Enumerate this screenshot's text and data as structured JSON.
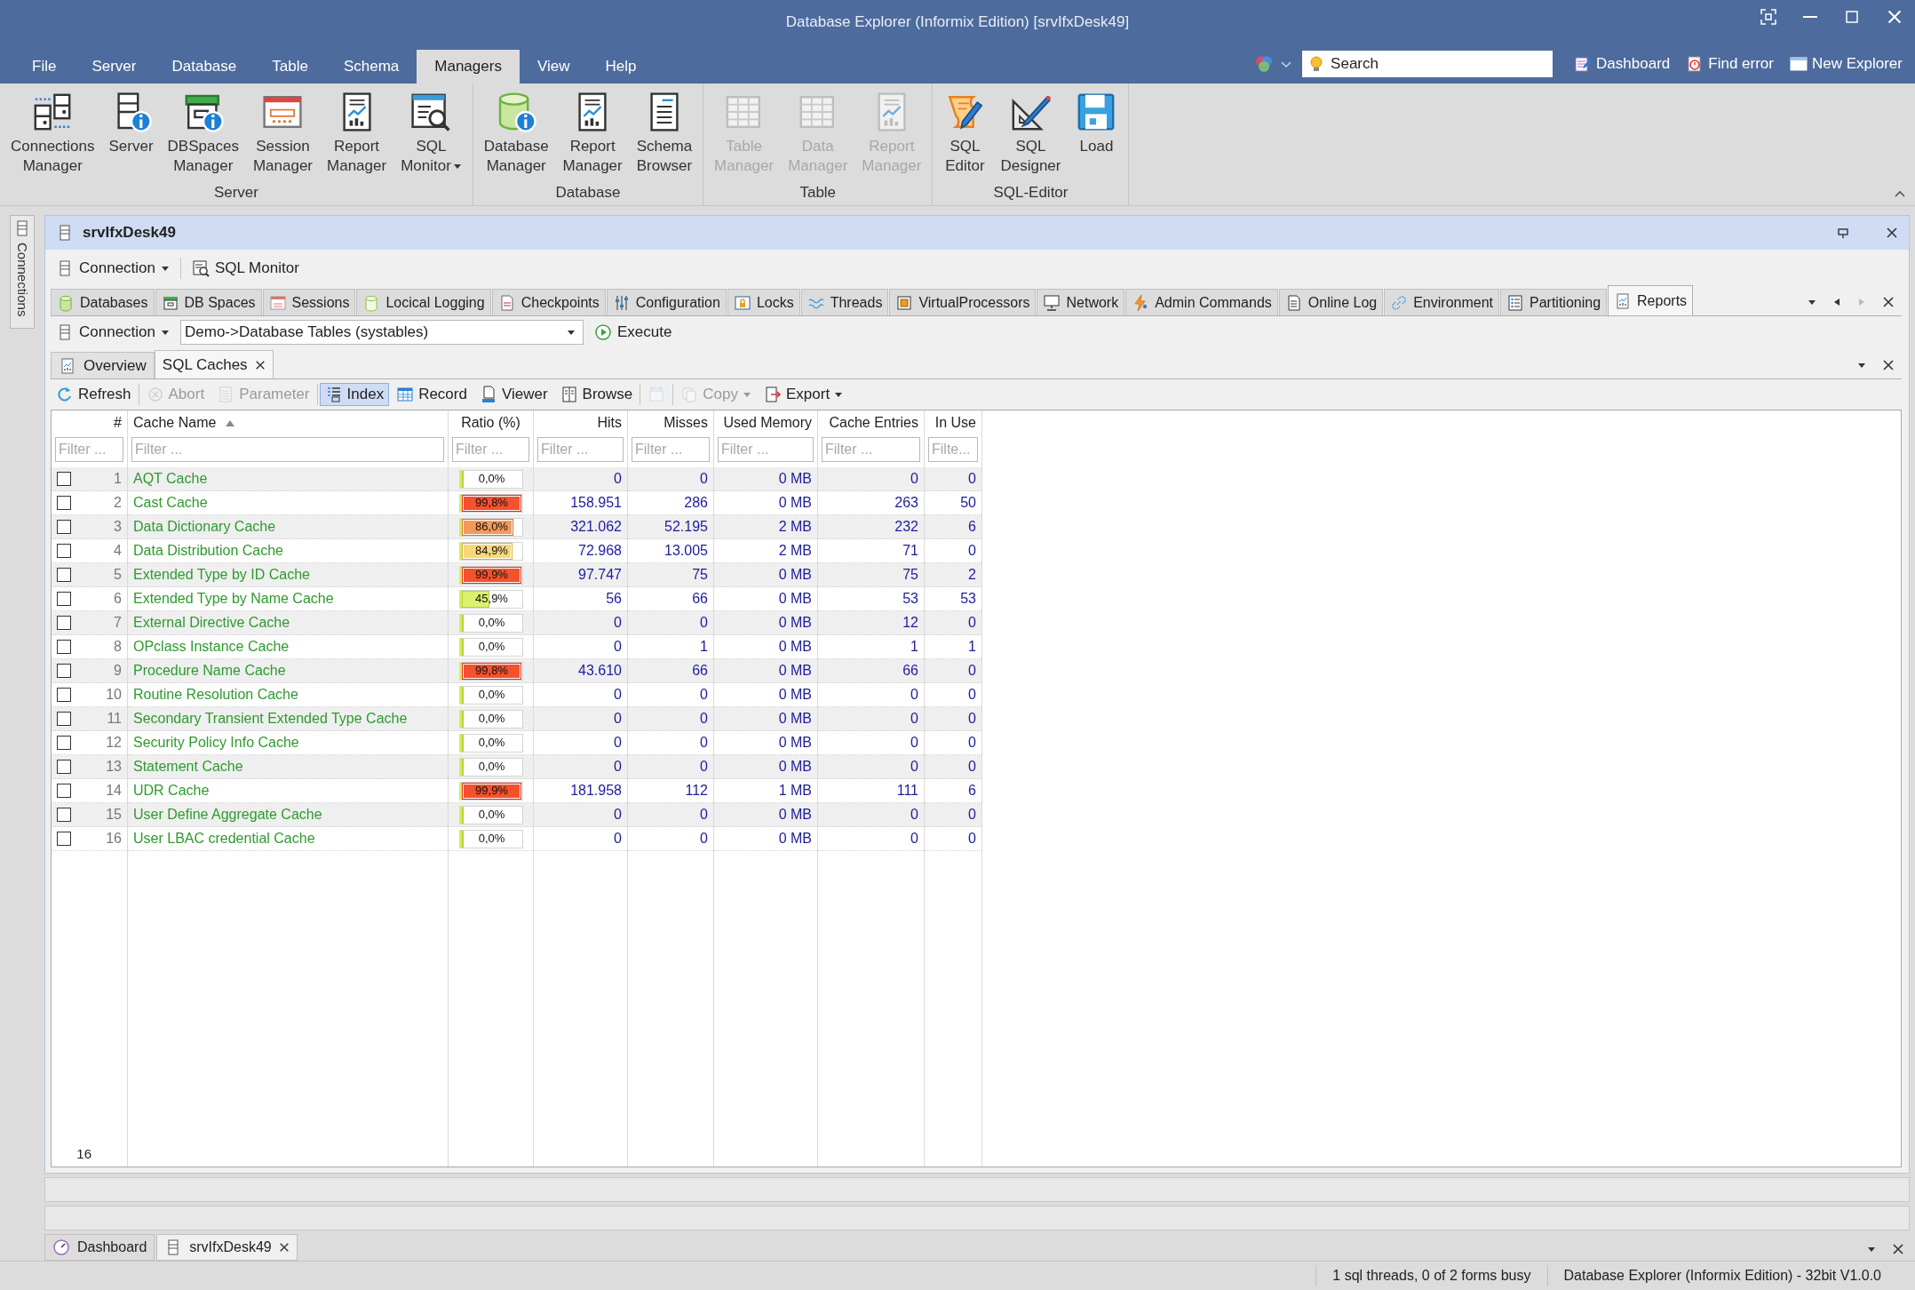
{
  "window": {
    "title": "Database Explorer (Informix Edition) [srvIfxDesk49]"
  },
  "menu": [
    {
      "label": "File",
      "selected": false
    },
    {
      "label": "Server",
      "selected": false
    },
    {
      "label": "Database",
      "selected": false
    },
    {
      "label": "Table",
      "selected": false
    },
    {
      "label": "Schema",
      "selected": false
    },
    {
      "label": "Managers",
      "selected": true
    },
    {
      "label": "View",
      "selected": false
    },
    {
      "label": "Help",
      "selected": false
    }
  ],
  "search": {
    "placeholder": "Search"
  },
  "quick_links": [
    "Dashboard",
    "Find error",
    "New Explorer"
  ],
  "ribbon": [
    {
      "label": "Server",
      "buttons": [
        {
          "lines": [
            "Connections",
            "Manager"
          ],
          "disabled": false,
          "dropdown": false
        },
        {
          "lines": [
            "Server"
          ],
          "disabled": false,
          "dropdown": false
        },
        {
          "lines": [
            "DBSpaces",
            "Manager"
          ],
          "disabled": false,
          "dropdown": false
        },
        {
          "lines": [
            "Session",
            "Manager"
          ],
          "disabled": false,
          "dropdown": false
        },
        {
          "lines": [
            "Report",
            "Manager"
          ],
          "disabled": false,
          "dropdown": false
        },
        {
          "lines": [
            "SQL",
            "Monitor"
          ],
          "disabled": false,
          "dropdown": true
        }
      ]
    },
    {
      "label": "Database",
      "buttons": [
        {
          "lines": [
            "Database",
            "Manager"
          ],
          "disabled": false,
          "dropdown": false
        },
        {
          "lines": [
            "Report",
            "Manager"
          ],
          "disabled": false,
          "dropdown": false
        },
        {
          "lines": [
            "Schema",
            "Browser"
          ],
          "disabled": false,
          "dropdown": false
        }
      ]
    },
    {
      "label": "Table",
      "buttons": [
        {
          "lines": [
            "Table",
            "Manager"
          ],
          "disabled": true,
          "dropdown": false
        },
        {
          "lines": [
            "Data",
            "Manager"
          ],
          "disabled": true,
          "dropdown": false
        },
        {
          "lines": [
            "Report",
            "Manager"
          ],
          "disabled": true,
          "dropdown": false
        }
      ]
    },
    {
      "label": "SQL-Editor",
      "buttons": [
        {
          "lines": [
            "SQL",
            "Editor"
          ],
          "disabled": false,
          "dropdown": false
        },
        {
          "lines": [
            "SQL",
            "Designer"
          ],
          "disabled": false,
          "dropdown": false
        },
        {
          "lines": [
            "Load"
          ],
          "disabled": false,
          "dropdown": false
        }
      ]
    }
  ],
  "side_panel": {
    "label": "Connections"
  },
  "document": {
    "title": "srvIfxDesk49",
    "toolbar": [
      {
        "label": "Connection",
        "dropdown": true
      },
      {
        "label": "SQL Monitor",
        "dropdown": false
      }
    ],
    "tabs": [
      {
        "label": "Databases",
        "selected": false
      },
      {
        "label": "DB Spaces",
        "selected": false
      },
      {
        "label": "Sessions",
        "selected": false
      },
      {
        "label": "Locical Logging",
        "selected": false
      },
      {
        "label": "Checkpoints",
        "selected": false
      },
      {
        "label": "Configuration",
        "selected": false
      },
      {
        "label": "Locks",
        "selected": false
      },
      {
        "label": "Threads",
        "selected": false
      },
      {
        "label": "VirtualProcessors",
        "selected": false
      },
      {
        "label": "Network",
        "selected": false
      },
      {
        "label": "Admin Commands",
        "selected": false
      },
      {
        "label": "Online Log",
        "selected": false
      },
      {
        "label": "Environment",
        "selected": false
      },
      {
        "label": "Partitioning",
        "selected": false
      },
      {
        "label": "Reports",
        "selected": true
      }
    ],
    "query": {
      "connection": "Connection",
      "source": "Demo->Database Tables (systables)",
      "run": "Execute"
    },
    "report_tabs": [
      {
        "label": "Overview",
        "selected": false,
        "closable": false
      },
      {
        "label": "SQL Caches",
        "selected": true,
        "closable": true
      }
    ],
    "actions": [
      {
        "label": "Refresh",
        "disabled": false,
        "on": false,
        "dropdown": false
      },
      {
        "label": "Abort",
        "disabled": true,
        "on": false,
        "dropdown": false
      },
      {
        "label": "Parameter",
        "disabled": true,
        "on": false,
        "dropdown": false
      },
      {
        "label": "Index",
        "disabled": false,
        "on": true,
        "dropdown": false
      },
      {
        "label": "Record",
        "disabled": false,
        "on": false,
        "dropdown": false
      },
      {
        "label": "Viewer",
        "disabled": false,
        "on": false,
        "dropdown": false
      },
      {
        "label": "Browse",
        "disabled": false,
        "on": false,
        "dropdown": false
      },
      {
        "disabled": true,
        "on": false,
        "dropdown": false
      },
      {
        "label": "Copy",
        "disabled": true,
        "on": false,
        "dropdown": true
      },
      {
        "label": "Export",
        "disabled": false,
        "on": false,
        "dropdown": true
      }
    ],
    "table": {
      "columns": [
        {
          "label": "#",
          "sorted": false,
          "filter_placeholder": "Filter ..."
        },
        {
          "label": "Cache Name",
          "sorted": true,
          "filter_placeholder": "Filter ..."
        },
        {
          "label": "Ratio (%)",
          "sorted": false,
          "filter_placeholder": "Filter ..."
        },
        {
          "label": "Hits",
          "sorted": false,
          "filter_placeholder": "Filter ..."
        },
        {
          "label": "Misses",
          "sorted": false,
          "filter_placeholder": "Filter ..."
        },
        {
          "label": "Used Memory",
          "sorted": false,
          "filter_placeholder": "Filter ..."
        },
        {
          "label": "Cache Entries",
          "sorted": false,
          "filter_placeholder": "Filter ..."
        },
        {
          "label": "In Use",
          "sorted": false,
          "filter_placeholder": "Filte..."
        }
      ],
      "rows": [
        {
          "checked": false,
          "number": "1",
          "name": "AQT Cache",
          "level": 0,
          "ratio": "0,0%",
          "hits": "0",
          "misses": "0",
          "used_memory": "0 MB",
          "cache_entries": "0",
          "in_use": "0"
        },
        {
          "checked": false,
          "number": "2",
          "name": "Cast Cache",
          "level": 0.998,
          "ratio": "99,8%",
          "hits": "158.951",
          "misses": "286",
          "used_memory": "0 MB",
          "cache_entries": "263",
          "in_use": "50"
        },
        {
          "checked": false,
          "number": "3",
          "name": "Data Dictionary Cache",
          "level": 0.86,
          "ratio": "86,0%",
          "hits": "321.062",
          "misses": "52.195",
          "used_memory": "2 MB",
          "cache_entries": "232",
          "in_use": "6"
        },
        {
          "checked": false,
          "number": "4",
          "name": "Data Distribution Cache",
          "level": 0.849,
          "ratio": "84,9%",
          "hits": "72.968",
          "misses": "13.005",
          "used_memory": "2 MB",
          "cache_entries": "71",
          "in_use": "0"
        },
        {
          "checked": false,
          "number": "5",
          "name": "Extended Type by ID Cache",
          "level": 0.999,
          "ratio": "99,9%",
          "hits": "97.747",
          "misses": "75",
          "used_memory": "0 MB",
          "cache_entries": "75",
          "in_use": "2"
        },
        {
          "checked": false,
          "number": "6",
          "name": "Extended Type by Name Cache",
          "level": 0.459,
          "ratio": "45,9%",
          "hits": "56",
          "misses": "66",
          "used_memory": "0 MB",
          "cache_entries": "53",
          "in_use": "53"
        },
        {
          "checked": false,
          "number": "7",
          "name": "External Directive Cache",
          "level": 0,
          "ratio": "0,0%",
          "hits": "0",
          "misses": "0",
          "used_memory": "0 MB",
          "cache_entries": "12",
          "in_use": "0"
        },
        {
          "checked": false,
          "number": "8",
          "name": "OPclass Instance Cache",
          "level": 0,
          "ratio": "0,0%",
          "hits": "0",
          "misses": "1",
          "used_memory": "0 MB",
          "cache_entries": "1",
          "in_use": "1"
        },
        {
          "checked": false,
          "number": "9",
          "name": "Procedure Name Cache",
          "level": 0.998,
          "ratio": "99,8%",
          "hits": "43.610",
          "misses": "66",
          "used_memory": "0 MB",
          "cache_entries": "66",
          "in_use": "0"
        },
        {
          "checked": false,
          "number": "10",
          "name": "Routine Resolution Cache",
          "level": 0,
          "ratio": "0,0%",
          "hits": "0",
          "misses": "0",
          "used_memory": "0 MB",
          "cache_entries": "0",
          "in_use": "0"
        },
        {
          "checked": false,
          "number": "11",
          "name": "Secondary Transient Extended Type Cache",
          "level": 0,
          "ratio": "0,0%",
          "hits": "0",
          "misses": "0",
          "used_memory": "0 MB",
          "cache_entries": "0",
          "in_use": "0"
        },
        {
          "checked": false,
          "number": "12",
          "name": "Security Policy Info Cache",
          "level": 0,
          "ratio": "0,0%",
          "hits": "0",
          "misses": "0",
          "used_memory": "0 MB",
          "cache_entries": "0",
          "in_use": "0"
        },
        {
          "checked": false,
          "number": "13",
          "name": "Statement Cache",
          "level": 0,
          "ratio": "0,0%",
          "hits": "0",
          "misses": "0",
          "used_memory": "0 MB",
          "cache_entries": "0",
          "in_use": "0"
        },
        {
          "checked": false,
          "number": "14",
          "name": "UDR Cache",
          "level": 0.999,
          "ratio": "99,9%",
          "hits": "181.958",
          "misses": "112",
          "used_memory": "1 MB",
          "cache_entries": "111",
          "in_use": "6"
        },
        {
          "checked": false,
          "number": "15",
          "name": "User Define Aggregate Cache",
          "level": 0,
          "ratio": "0,0%",
          "hits": "0",
          "misses": "0",
          "used_memory": "0 MB",
          "cache_entries": "0",
          "in_use": "0"
        },
        {
          "checked": false,
          "number": "16",
          "name": "User LBAC credential Cache",
          "level": 0,
          "ratio": "0,0%",
          "hits": "0",
          "misses": "0",
          "used_memory": "0 MB",
          "cache_entries": "0",
          "in_use": "0"
        }
      ],
      "footer": "16"
    }
  },
  "bottom_tabs": [
    {
      "label": "Dashboard",
      "selected": false,
      "closable": false
    },
    {
      "label": "srvIfxDesk49",
      "selected": true,
      "closable": true
    }
  ],
  "status_bar": [
    "1 sql threads, 0 of 2 forms busy",
    "Database Explorer (Informix Edition) - 32bit V1.0.0"
  ]
}
